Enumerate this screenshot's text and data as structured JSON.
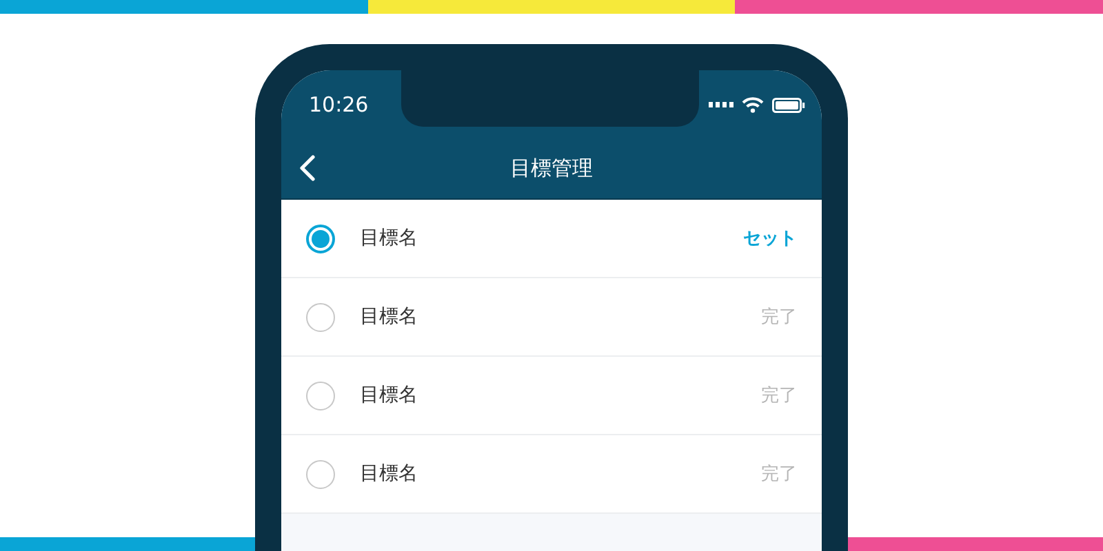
{
  "status_bar": {
    "time": "10:26"
  },
  "nav_bar": {
    "title": "目標管理"
  },
  "goals": [
    {
      "name": "目標名",
      "selected": true,
      "action": "セット"
    },
    {
      "name": "目標名",
      "selected": false,
      "action": "完了"
    },
    {
      "name": "目標名",
      "selected": false,
      "action": "完了"
    },
    {
      "name": "目標名",
      "selected": false,
      "action": "完了"
    }
  ]
}
